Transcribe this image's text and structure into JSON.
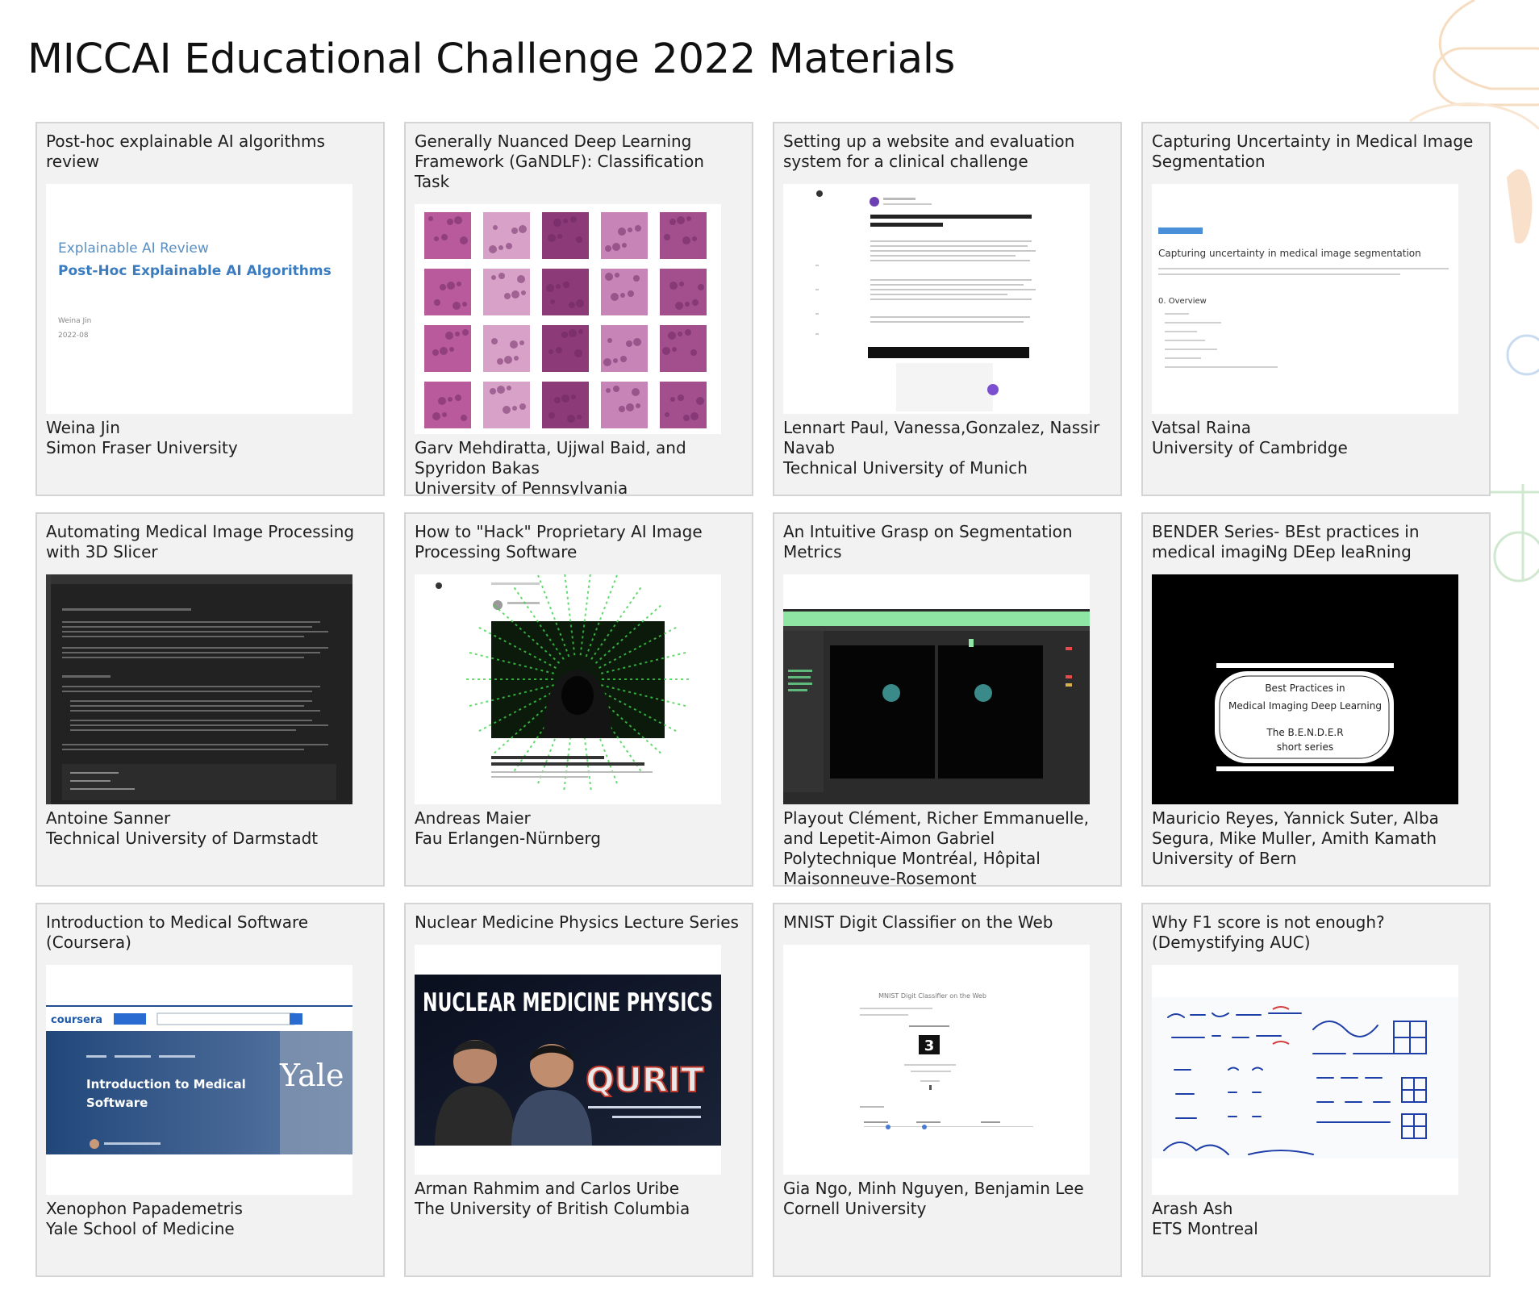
{
  "page": {
    "title": "MICCAI Educational Challenge 2022 Materials"
  },
  "cards": [
    {
      "title": "Post-hoc explainable AI algorithms review",
      "authors": "Weina Jin",
      "affiliation": "Simon Fraser University",
      "thumb": {
        "icon": "slide-thumbnail",
        "line1": "Explainable AI Review",
        "line2": "Post-Hoc Explainable AI Algorithms",
        "meta1": "Weina Jin",
        "meta2": "2022-08"
      }
    },
    {
      "title": "Generally Nuanced Deep Learning Framework (GaNDLF): Classification Task",
      "authors": "Garv Mehdiratta, Ujjwal Baid, and Spyridon Bakas",
      "affiliation": "University of Pennsylvania",
      "thumb": {
        "icon": "histology-grid-thumbnail"
      }
    },
    {
      "title": "Setting up a website and evaluation system for a clinical challenge",
      "authors": "Lennart Paul, Vanessa,Gonzalez, Nassir Navab",
      "affiliation": "Technical University of Munich",
      "thumb": {
        "icon": "blog-post-thumbnail"
      }
    },
    {
      "title": "Capturing Uncertainty in Medical Image Segmentation",
      "authors": "Vatsal Raina",
      "affiliation": "University of Cambridge",
      "thumb": {
        "icon": "document-thumbnail",
        "line1": "Capturing uncertainty in medical image segmentation",
        "meta1": "0. Overview"
      }
    },
    {
      "title": "Automating Medical Image Processing with 3D Slicer",
      "authors": "Antoine Sanner",
      "affiliation": "Technical University of Darmstadt",
      "thumb": {
        "icon": "dark-notebook-thumbnail"
      }
    },
    {
      "title": "How to \"Hack\" Proprietary AI Image Processing Software",
      "authors": "Andreas Maier",
      "affiliation": "Fau Erlangen-Nürnberg",
      "thumb": {
        "icon": "hacker-blog-thumbnail"
      }
    },
    {
      "title": "An Intuitive Grasp on Segmentation Metrics",
      "authors": "Playout Clément, Richer Emmanuelle, and Lepetit-Aimon Gabriel",
      "affiliation": "Polytechnique Montréal, Hôpital Maisonneuve-Rosemont",
      "thumb": {
        "icon": "app-screenshot-thumbnail"
      }
    },
    {
      "title": "BENDER Series- BEst practices in medical imagiNg DEep leaRning",
      "authors": "Mauricio Reyes, Yannick Suter, Alba Segura, Mike Muller, Amith Kamath",
      "affiliation": "University of Bern",
      "thumb": {
        "icon": "video-title-thumbnail",
        "line1": "Best Practices in",
        "line2": "Medical Imaging Deep Learning",
        "meta1": "The B.E.N.D.E.R",
        "meta2": "short series"
      }
    },
    {
      "title": "Introduction to Medical Software (Coursera)",
      "authors": "Xenophon Papademetris",
      "affiliation": "Yale School of Medicine",
      "thumb": {
        "icon": "coursera-thumbnail",
        "line1": "Introduction to Medical",
        "line2": "Software",
        "meta1": "coursera",
        "meta2": "Yale"
      }
    },
    {
      "title": "Nuclear Medicine Physics Lecture Series",
      "authors": "Arman Rahmim and Carlos Uribe",
      "affiliation": "The University of British Columbia",
      "thumb": {
        "icon": "lecture-banner-thumbnail",
        "line1": "NUCLEAR MEDICINE PHYSICS",
        "meta1": "QURIT"
      }
    },
    {
      "title": "MNIST Digit Classifier on the Web",
      "authors": "Gia Ngo, Minh Nguyen, Benjamin Lee",
      "affiliation": "Cornell University",
      "thumb": {
        "icon": "web-app-thumbnail",
        "line1": "MNIST Digit Classifier on the Web",
        "meta1": "3"
      }
    },
    {
      "title": "Why F1 score is not enough? (Demystifying AUC)",
      "authors": "Arash Ash",
      "affiliation": "ETS Montreal",
      "thumb": {
        "icon": "whiteboard-thumbnail"
      }
    }
  ],
  "colors": {
    "card_bg": "#f2f2f2",
    "card_border": "#d4d4d4",
    "deco": "#f3c99a",
    "deco_green": "#bfe3c0"
  }
}
